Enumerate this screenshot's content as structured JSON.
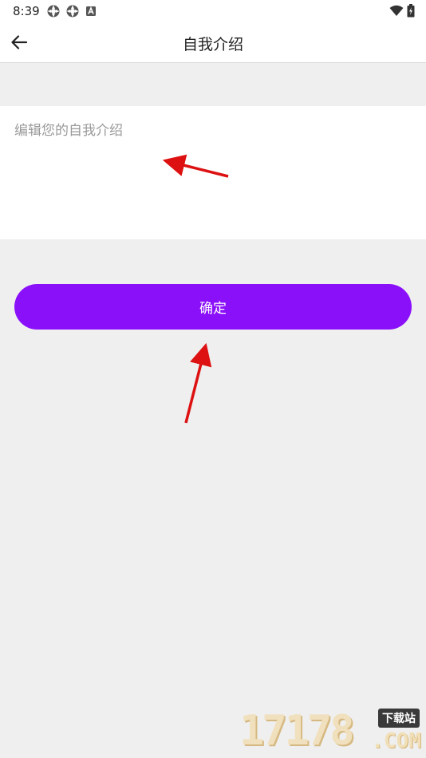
{
  "status_bar": {
    "time": "8:39",
    "left_icons": [
      "settings-icon",
      "settings-icon",
      "a-notification-icon"
    ],
    "right_icons": [
      "wifi-icon",
      "battery-icon"
    ]
  },
  "header": {
    "back_icon": "arrow-left-icon",
    "title": "自我介绍"
  },
  "intro": {
    "placeholder": "编辑您的自我介绍",
    "value": ""
  },
  "confirm_button": {
    "label": "确定",
    "color": "#8b10fa"
  },
  "watermark": {
    "digits": "17178",
    "tag": "下载站",
    "suffix": ".COM"
  }
}
